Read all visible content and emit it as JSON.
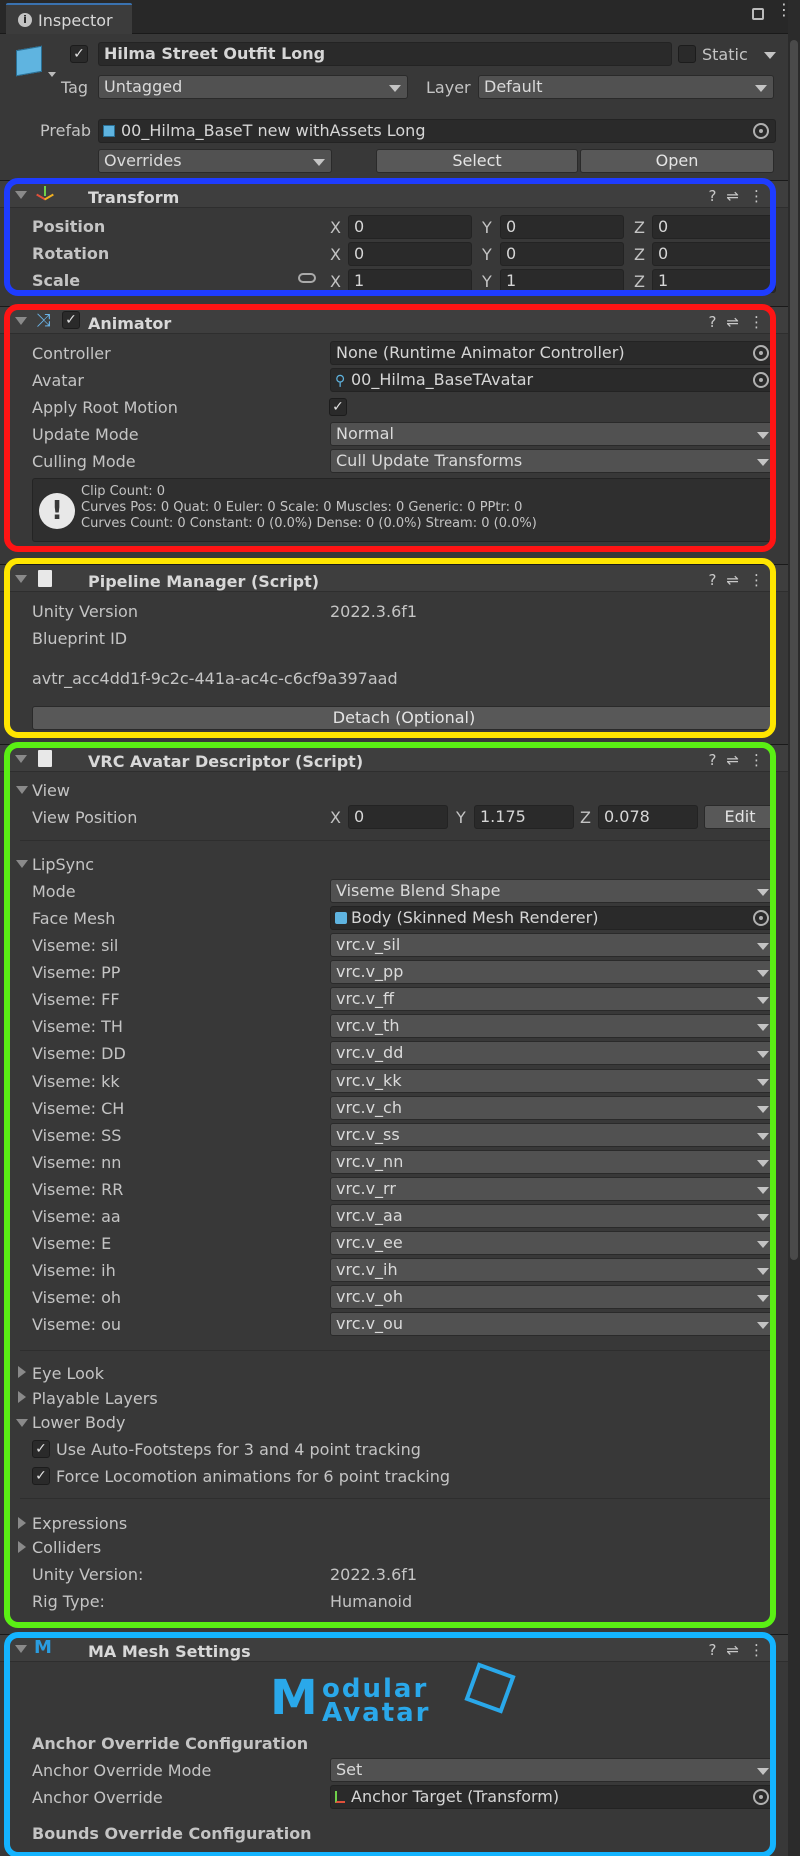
{
  "tab": {
    "title": "Inspector"
  },
  "object": {
    "name": "Hilma Street Outfit Long",
    "active": true,
    "static_label": "Static",
    "tag_label": "Tag",
    "tag_value": "Untagged",
    "layer_label": "Layer",
    "layer_value": "Default",
    "prefab_label": "Prefab",
    "prefab_value": "00_Hilma_BaseT new withAssets Long",
    "overrides": "Overrides",
    "select": "Select",
    "open": "Open"
  },
  "transform": {
    "title": "Transform",
    "rows": [
      {
        "label": "Position",
        "x": "0",
        "y": "0",
        "z": "0"
      },
      {
        "label": "Rotation",
        "x": "0",
        "y": "0",
        "z": "0"
      },
      {
        "label": "Scale",
        "x": "1",
        "y": "1",
        "z": "1"
      }
    ]
  },
  "animator": {
    "title": "Animator",
    "controller_label": "Controller",
    "controller": "None (Runtime Animator Controller)",
    "avatar_label": "Avatar",
    "avatar": "00_Hilma_BaseTAvatar",
    "root_label": "Apply Root Motion",
    "update_label": "Update Mode",
    "update": "Normal",
    "culling_label": "Culling Mode",
    "culling": "Cull Update Transforms",
    "info": [
      "Clip Count: 0",
      "Curves Pos: 0 Quat: 0 Euler: 0 Scale: 0 Muscles: 0 Generic: 0 PPtr: 0",
      "Curves Count: 0 Constant: 0 (0.0%) Dense: 0 (0.0%) Stream: 0 (0.0%)"
    ]
  },
  "pipeline": {
    "title": "Pipeline Manager (Script)",
    "unity_label": "Unity Version",
    "unity": "2022.3.6f1",
    "blueprint_label": "Blueprint ID",
    "blueprint": "avtr_acc4dd1f-9c2c-441a-ac4c-c6cf9a397aad",
    "detach": "Detach (Optional)"
  },
  "descriptor": {
    "title": "VRC Avatar Descriptor (Script)",
    "view": "View",
    "view_pos_label": "View Position",
    "vx": "0",
    "vy": "1.175",
    "vz": "0.078",
    "edit": "Edit",
    "lipsync": "LipSync",
    "mode_label": "Mode",
    "mode": "Viseme Blend Shape",
    "face_label": "Face Mesh",
    "face": "Body (Skinned Mesh Renderer)",
    "visemes": [
      {
        "label": "Viseme: sil",
        "value": "vrc.v_sil"
      },
      {
        "label": "Viseme: PP",
        "value": "vrc.v_pp"
      },
      {
        "label": "Viseme: FF",
        "value": "vrc.v_ff"
      },
      {
        "label": "Viseme: TH",
        "value": "vrc.v_th"
      },
      {
        "label": "Viseme: DD",
        "value": "vrc.v_dd"
      },
      {
        "label": "Viseme: kk",
        "value": "vrc.v_kk"
      },
      {
        "label": "Viseme: CH",
        "value": "vrc.v_ch"
      },
      {
        "label": "Viseme: SS",
        "value": "vrc.v_ss"
      },
      {
        "label": "Viseme: nn",
        "value": "vrc.v_nn"
      },
      {
        "label": "Viseme: RR",
        "value": "vrc.v_rr"
      },
      {
        "label": "Viseme: aa",
        "value": "vrc.v_aa"
      },
      {
        "label": "Viseme: E",
        "value": "vrc.v_ee"
      },
      {
        "label": "Viseme: ih",
        "value": "vrc.v_ih"
      },
      {
        "label": "Viseme: oh",
        "value": "vrc.v_oh"
      },
      {
        "label": "Viseme: ou",
        "value": "vrc.v_ou"
      }
    ],
    "eye": "Eye Look",
    "playable": "Playable Layers",
    "lower": "Lower Body",
    "foot": "Use Auto-Footsteps for 3 and 4 point tracking",
    "force": "Force Locomotion animations for 6 point tracking",
    "expr": "Expressions",
    "coll": "Colliders",
    "uv_label": "Unity Version:",
    "uv": "2022.3.6f1",
    "rig_label": "Rig Type:",
    "rig": "Humanoid"
  },
  "ma": {
    "title": "MA Mesh Settings",
    "logo_top": "odular",
    "logo_bottom": "Avatar",
    "anchor_cfg": "Anchor Override Configuration",
    "anchor_mode_label": "Anchor Override Mode",
    "anchor_mode": "Set",
    "anchor_label": "Anchor Override",
    "anchor": "Anchor Target (Transform)",
    "bounds_cfg": "Bounds Override Configuration"
  },
  "axes": {
    "x": "X",
    "y": "Y",
    "z": "Z"
  },
  "colors": {
    "blue": "#1e3cff",
    "red": "#ff1414",
    "yellow": "#ffe600",
    "green": "#5aef14",
    "cyan": "#14b4ff"
  }
}
